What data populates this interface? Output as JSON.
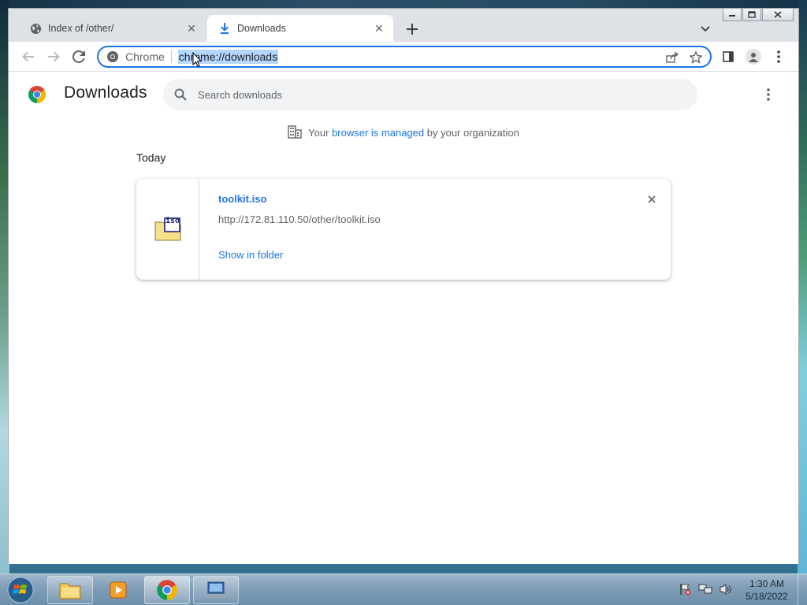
{
  "window": {
    "tabs": [
      {
        "label": "Index of /other/",
        "icon": "globe-icon"
      },
      {
        "label": "Downloads",
        "icon": "download-icon",
        "active": true
      }
    ],
    "controls": {
      "minimize": "minimize-icon",
      "maximize": "maximize-icon",
      "close": "close-icon"
    }
  },
  "toolbar": {
    "omnibox_chip": "Chrome",
    "omnibox_url": "chrome://downloads"
  },
  "page": {
    "title": "Downloads",
    "search_placeholder": "Search downloads",
    "managed": {
      "prefix": "Your",
      "link": "browser is managed",
      "suffix": "by your organization"
    },
    "date_group": "Today",
    "downloads": [
      {
        "file_name": "toolkit.iso",
        "url": "http://172.81.110.50/other/toolkit.iso",
        "action": "Show in folder",
        "icon_label": "iso"
      }
    ]
  },
  "taskbar": {
    "items": [
      "start-button",
      "windows-explorer",
      "media-player",
      "google-chrome",
      "remote-desktop"
    ],
    "clock_time": "1:30 AM",
    "clock_date": "5/18/2022"
  },
  "colors": {
    "accent": "#1a73e8",
    "url_selection": "#b4d7ff",
    "tabstrip": "#dee1e6",
    "search_bg": "#f1f3f4"
  }
}
